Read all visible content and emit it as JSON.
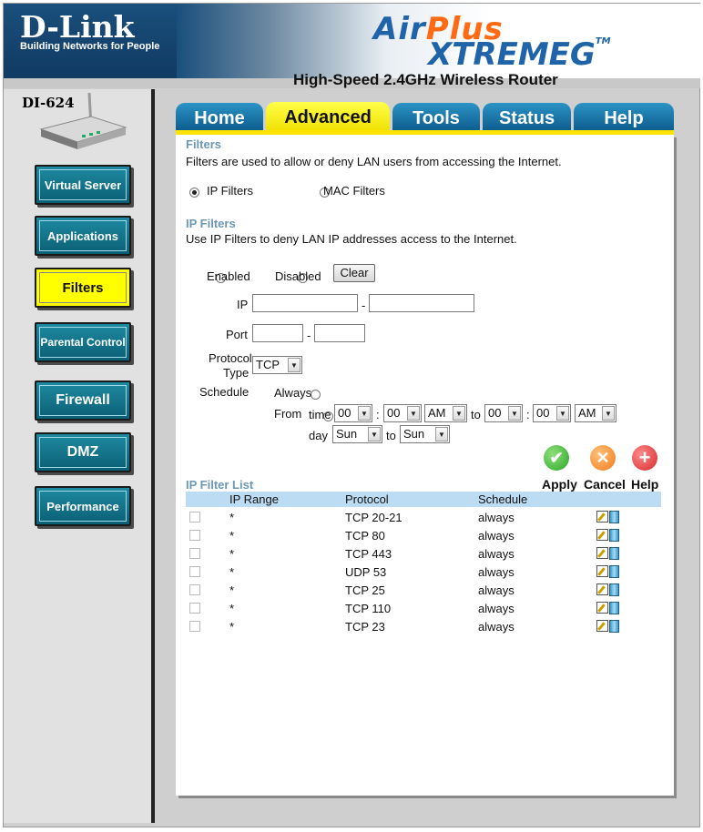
{
  "brand": {
    "logo": "D-Link",
    "tagline": "Building Networks for People",
    "product_air": "Air",
    "product_plus": "Plus",
    "product_xtreme": "XTREME",
    "product_g": "G",
    "tm": "TM",
    "subtitle": "High-Speed 2.4GHz Wireless Router",
    "model": "DI-624"
  },
  "sidebar": {
    "items": [
      {
        "label": "Virtual Server"
      },
      {
        "label": "Applications"
      },
      {
        "label": "Filters",
        "active": true
      },
      {
        "label": "Parental Control"
      },
      {
        "label": "Firewall"
      },
      {
        "label": "DMZ"
      },
      {
        "label": "Performance"
      }
    ]
  },
  "tabs": [
    {
      "label": "Home"
    },
    {
      "label": "Advanced",
      "active": true
    },
    {
      "label": "Tools"
    },
    {
      "label": "Status"
    },
    {
      "label": "Help"
    }
  ],
  "filters": {
    "title": "Filters",
    "description": "Filters are used to allow or deny LAN users from accessing the Internet.",
    "type_ip_label": "IP Filters",
    "type_mac_label": "MAC Filters",
    "selected_type": "IP Filters"
  },
  "ip_filters": {
    "title": "IP Filters",
    "description": "Use IP Filters to deny LAN IP addresses access to the Internet.",
    "enabled_label": "Enabled",
    "disabled_label": "Disabled",
    "clear_label": "Clear",
    "ip_label": "IP",
    "ip_start": "",
    "ip_end": "",
    "dash": "-",
    "port_label": "Port",
    "port_start": "",
    "port_end": "",
    "protocol_label_1": "Protocol",
    "protocol_label_2": "Type",
    "protocol_value": "TCP",
    "schedule_label": "Schedule",
    "always_label": "Always",
    "from_label": "From",
    "time_label": "time",
    "to_label": "to",
    "colon": ":",
    "day_label": "day",
    "start_hour": "00",
    "start_min": "00",
    "start_ampm": "AM",
    "end_hour": "00",
    "end_min": "00",
    "end_ampm": "AM",
    "start_day": "Sun",
    "end_day": "Sun"
  },
  "actions": {
    "apply": "Apply",
    "cancel": "Cancel",
    "help": "Help"
  },
  "filter_list": {
    "title": "IP Filter List",
    "headers": {
      "ip_range": "IP Range",
      "protocol": "Protocol",
      "schedule": "Schedule"
    },
    "rows": [
      {
        "ip_range": "*",
        "protocol": "TCP 20-21",
        "schedule": "always"
      },
      {
        "ip_range": "*",
        "protocol": "TCP 80",
        "schedule": "always"
      },
      {
        "ip_range": "*",
        "protocol": "TCP 443",
        "schedule": "always"
      },
      {
        "ip_range": "*",
        "protocol": "UDP 53",
        "schedule": "always"
      },
      {
        "ip_range": "*",
        "protocol": "TCP 25",
        "schedule": "always"
      },
      {
        "ip_range": "*",
        "protocol": "TCP 110",
        "schedule": "always"
      },
      {
        "ip_range": "*",
        "protocol": "TCP 23",
        "schedule": "always"
      }
    ]
  },
  "colors": {
    "brand_blue": "#1a4f7c",
    "nav_teal": "#0b5f74",
    "active_yellow": "#ffff00",
    "section_title": "#6b97b3",
    "table_header": "#bcdcf4",
    "apply_green": "#2aa52a",
    "cancel_orange": "#f07a1a",
    "help_red": "#d42a2a"
  }
}
